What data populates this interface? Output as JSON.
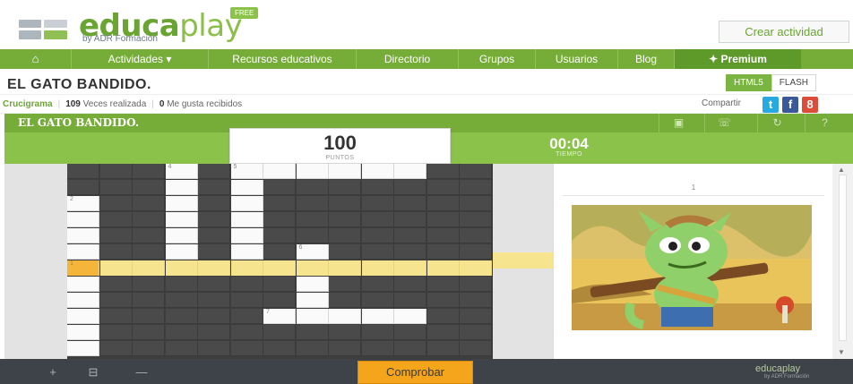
{
  "logo": {
    "edu": "educa",
    "play": "play",
    "sub": "by ADR Formación",
    "free": "FREE"
  },
  "header": {
    "create_label": "Crear actividad"
  },
  "nav": {
    "home_icon": "home-icon",
    "items": [
      "Actividades ▾",
      "Recursos educativos",
      "Directorio",
      "Grupos",
      "Usuarios",
      "Blog",
      "✦ Premium"
    ]
  },
  "page": {
    "title": "EL GATO BANDIDO."
  },
  "formats": {
    "html5": "HTML5",
    "flash": "FLASH"
  },
  "info": {
    "category": "Crucigrama",
    "times_count": "109",
    "times_label": "Veces realizada",
    "likes_count": "0",
    "likes_label": "Me gusta recibidos"
  },
  "share": {
    "label": "Compartir",
    "twitter": "t",
    "facebook": "f",
    "google": "8"
  },
  "game": {
    "title": "EL GATO BANDIDO.",
    "controls": [
      "fullscreen-icon",
      "keyboard-icon",
      "restart-icon",
      "help-icon"
    ],
    "score_value": "100",
    "score_label": "PUNTOS",
    "time_value": "00:04",
    "time_label": "TIEMPO"
  },
  "grid": {
    "numbers": {
      "r0c3": "4",
      "r0c5": "5",
      "r2c0": "2",
      "r5c7": "6",
      "r6c0": "1",
      "r9c6": "7"
    }
  },
  "clue": {
    "number": "1"
  },
  "footer": {
    "zoom_in": "+",
    "zoom_fit": "⊟",
    "zoom_out": "—",
    "check_label": "Comprobar",
    "logo": "educaplay",
    "logo_sub": "by ADR Formación"
  },
  "colors": {
    "brand_green": "#76ad38",
    "accent_orange": "#f4a51c",
    "highlight_yellow": "#f6e48e"
  }
}
